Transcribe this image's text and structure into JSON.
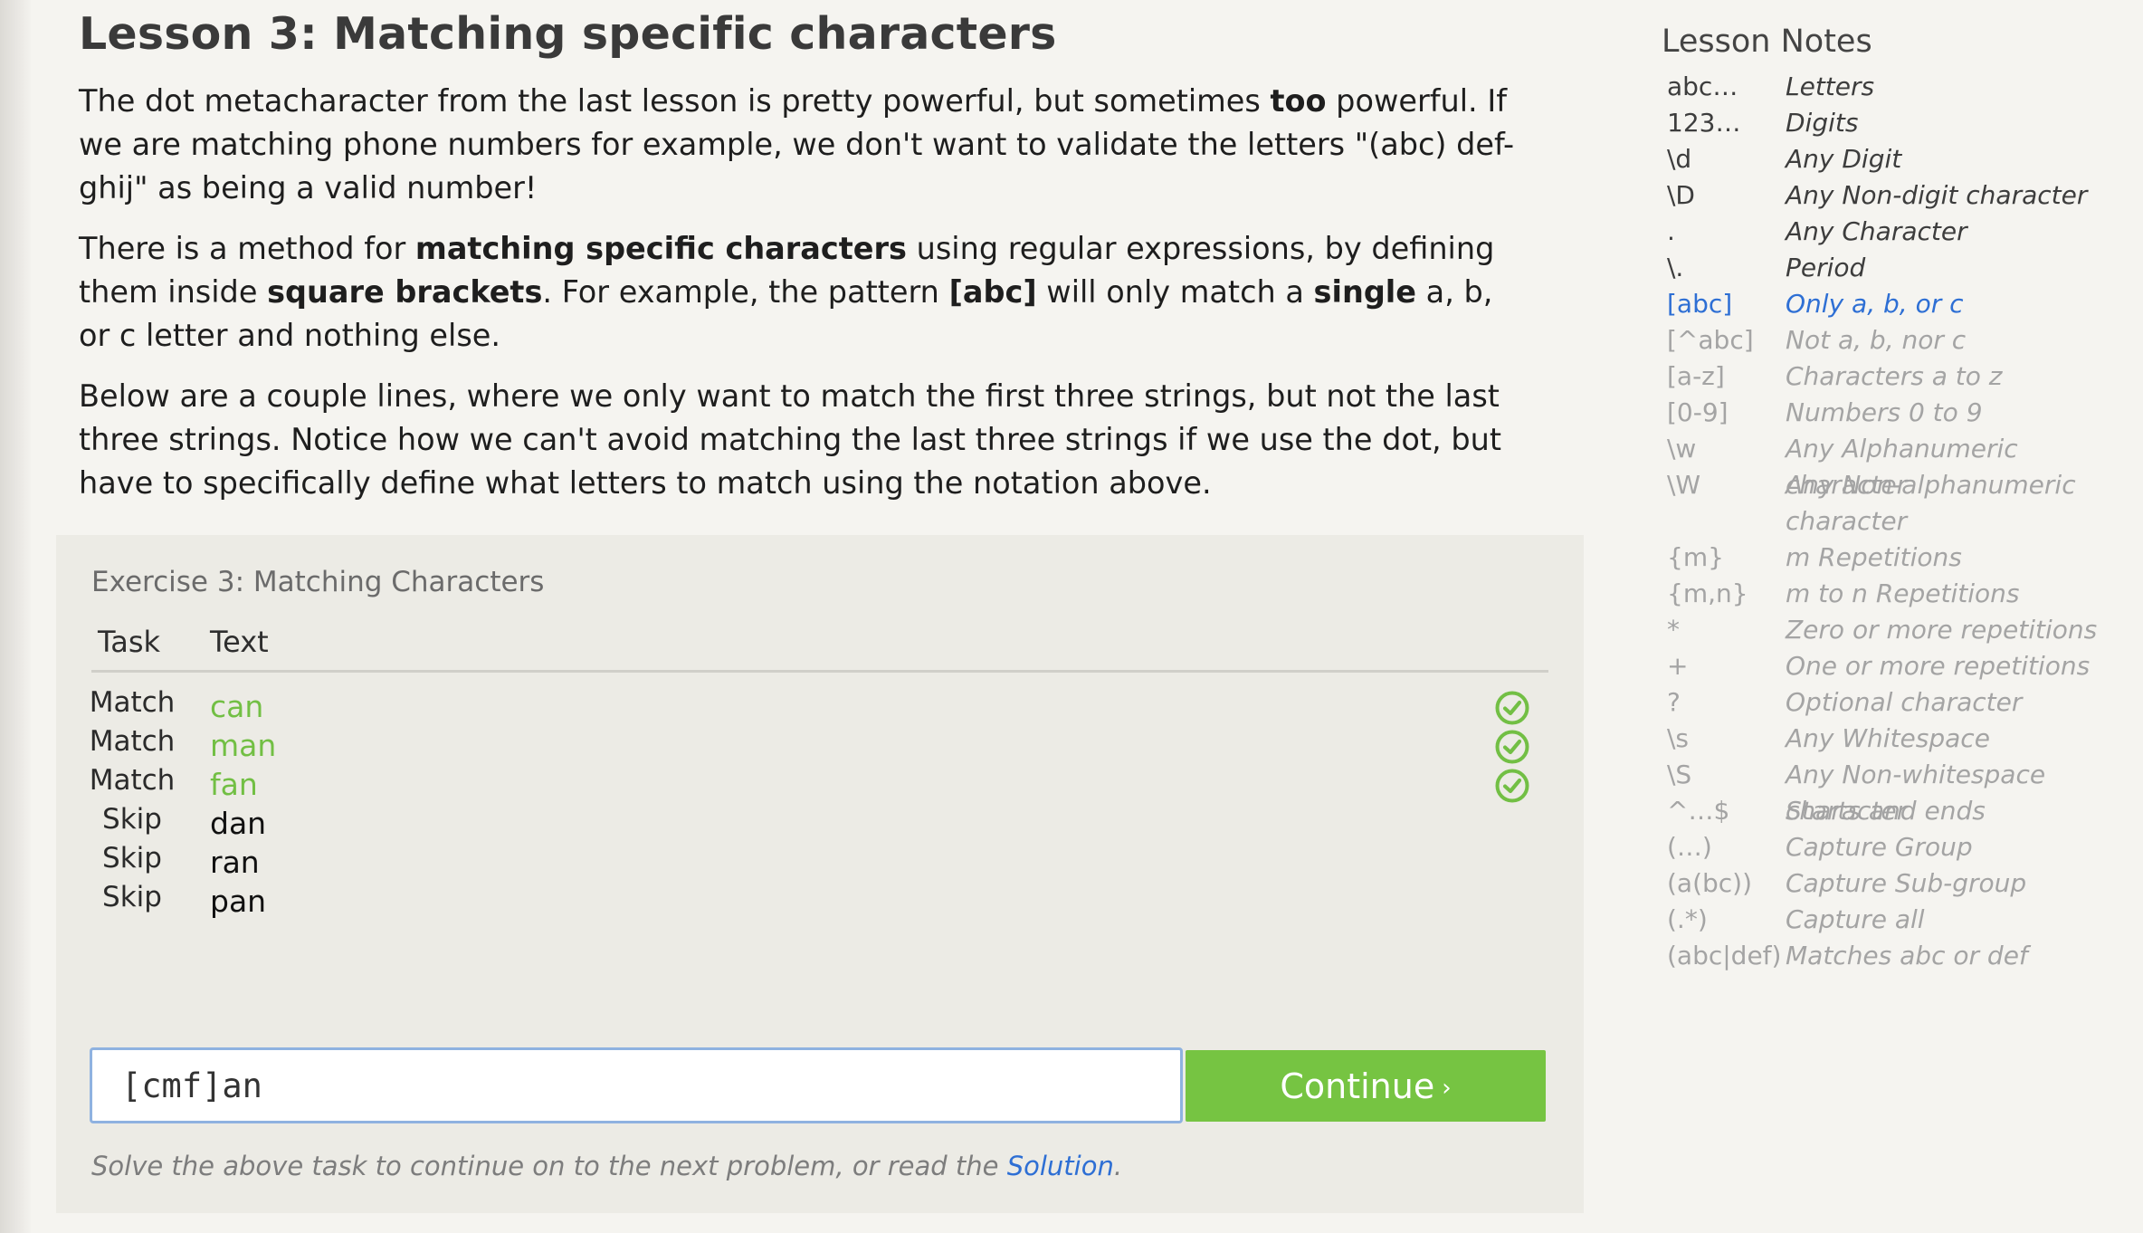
{
  "lesson": {
    "title": "Lesson 3: Matching specific characters",
    "paragraphs": [
      [
        {
          "t": "The dot metacharacter from the last lesson is pretty powerful, but sometimes ",
          "b": false
        },
        {
          "t": "too",
          "b": true
        },
        {
          "t": " powerful. If we are matching phone numbers for example, we don't want to validate the letters \"(abc) def-ghij\" as being a valid number!",
          "b": false
        }
      ],
      [
        {
          "t": "There is a method for ",
          "b": false
        },
        {
          "t": "matching specific characters",
          "b": true
        },
        {
          "t": " using regular expressions, by defining them inside ",
          "b": false
        },
        {
          "t": "square brackets",
          "b": true
        },
        {
          "t": ". For example, the pattern ",
          "b": false
        },
        {
          "t": "[abc]",
          "b": true
        },
        {
          "t": " will only match a ",
          "b": false
        },
        {
          "t": "single",
          "b": true
        },
        {
          "t": " a, b, or c letter and nothing else.",
          "b": false
        }
      ],
      [
        {
          "t": "Below are a couple lines, where we only want to match the first three strings, but not the last three strings. Notice how we can't avoid matching the last three strings if we use the dot, but have to specifically define what letters to match using the notation above.",
          "b": false
        }
      ]
    ]
  },
  "exercise": {
    "title": "Exercise 3: Matching Characters",
    "col_task": "Task",
    "col_text": "Text",
    "rows": [
      {
        "task": "Match",
        "text": "can",
        "passed": true
      },
      {
        "task": "Match",
        "text": "man",
        "passed": true
      },
      {
        "task": "Match",
        "text": "fan",
        "passed": true
      },
      {
        "task": "Skip",
        "text": "dan",
        "passed": false
      },
      {
        "task": "Skip",
        "text": "ran",
        "passed": false
      },
      {
        "task": "Skip",
        "text": "pan",
        "passed": false
      }
    ],
    "input_value": "[cmf]an",
    "continue_label": "Continue",
    "continue_chevron": "›",
    "footnote_text": "Solve the above task to continue on to the next problem, or read the ",
    "footnote_link": "Solution",
    "footnote_end": "."
  },
  "notes": {
    "title": "Lesson Notes",
    "items": [
      {
        "key": "abc…",
        "desc": "Letters",
        "state": "learned"
      },
      {
        "key": "123…",
        "desc": "Digits",
        "state": "learned"
      },
      {
        "key": "\\d",
        "desc": "Any Digit",
        "state": "learned"
      },
      {
        "key": "\\D",
        "desc": "Any Non-digit character",
        "state": "learned"
      },
      {
        "key": ".",
        "desc": "Any Character",
        "state": "learned"
      },
      {
        "key": "\\.",
        "desc": "Period",
        "state": "learned"
      },
      {
        "key": "[abc]",
        "desc": "Only a, b, or c",
        "state": "current"
      },
      {
        "key": "[^abc]",
        "desc": "Not a, b, nor c",
        "state": "future"
      },
      {
        "key": "[a-z]",
        "desc": "Characters a to z",
        "state": "future"
      },
      {
        "key": "[0-9]",
        "desc": "Numbers 0 to 9",
        "state": "future"
      },
      {
        "key": "\\w",
        "desc": "Any Alphanumeric character",
        "state": "future"
      },
      {
        "key": "\\W",
        "desc": "Any Non-alphanumeric character",
        "state": "future"
      },
      {
        "key": "{m}",
        "desc": "m Repetitions",
        "state": "future"
      },
      {
        "key": "{m,n}",
        "desc": "m to n Repetitions",
        "state": "future"
      },
      {
        "key": "*",
        "desc": "Zero or more repetitions",
        "state": "future"
      },
      {
        "key": "+",
        "desc": "One or more repetitions",
        "state": "future"
      },
      {
        "key": "?",
        "desc": "Optional character",
        "state": "future"
      },
      {
        "key": "\\s",
        "desc": "Any Whitespace",
        "state": "future"
      },
      {
        "key": "\\S",
        "desc": "Any Non-whitespace character",
        "state": "future"
      },
      {
        "key": "^…$",
        "desc": "Starts and ends",
        "state": "future"
      },
      {
        "key": "(…)",
        "desc": "Capture Group",
        "state": "future"
      },
      {
        "key": "(a(bc))",
        "desc": "Capture Sub-group",
        "state": "future"
      },
      {
        "key": "(.*)",
        "desc": "Capture all",
        "state": "future"
      },
      {
        "key": "(abc|def)",
        "desc": "Matches abc or def",
        "state": "future"
      }
    ]
  },
  "colors": {
    "accent_green": "#76c442",
    "match_text": "#72bf44",
    "link_blue": "#2e6fd4",
    "input_border": "#8fb2e0"
  },
  "icons": {
    "row_passed": "check-circle-icon",
    "continue_chevron": "chevron-right-icon"
  }
}
